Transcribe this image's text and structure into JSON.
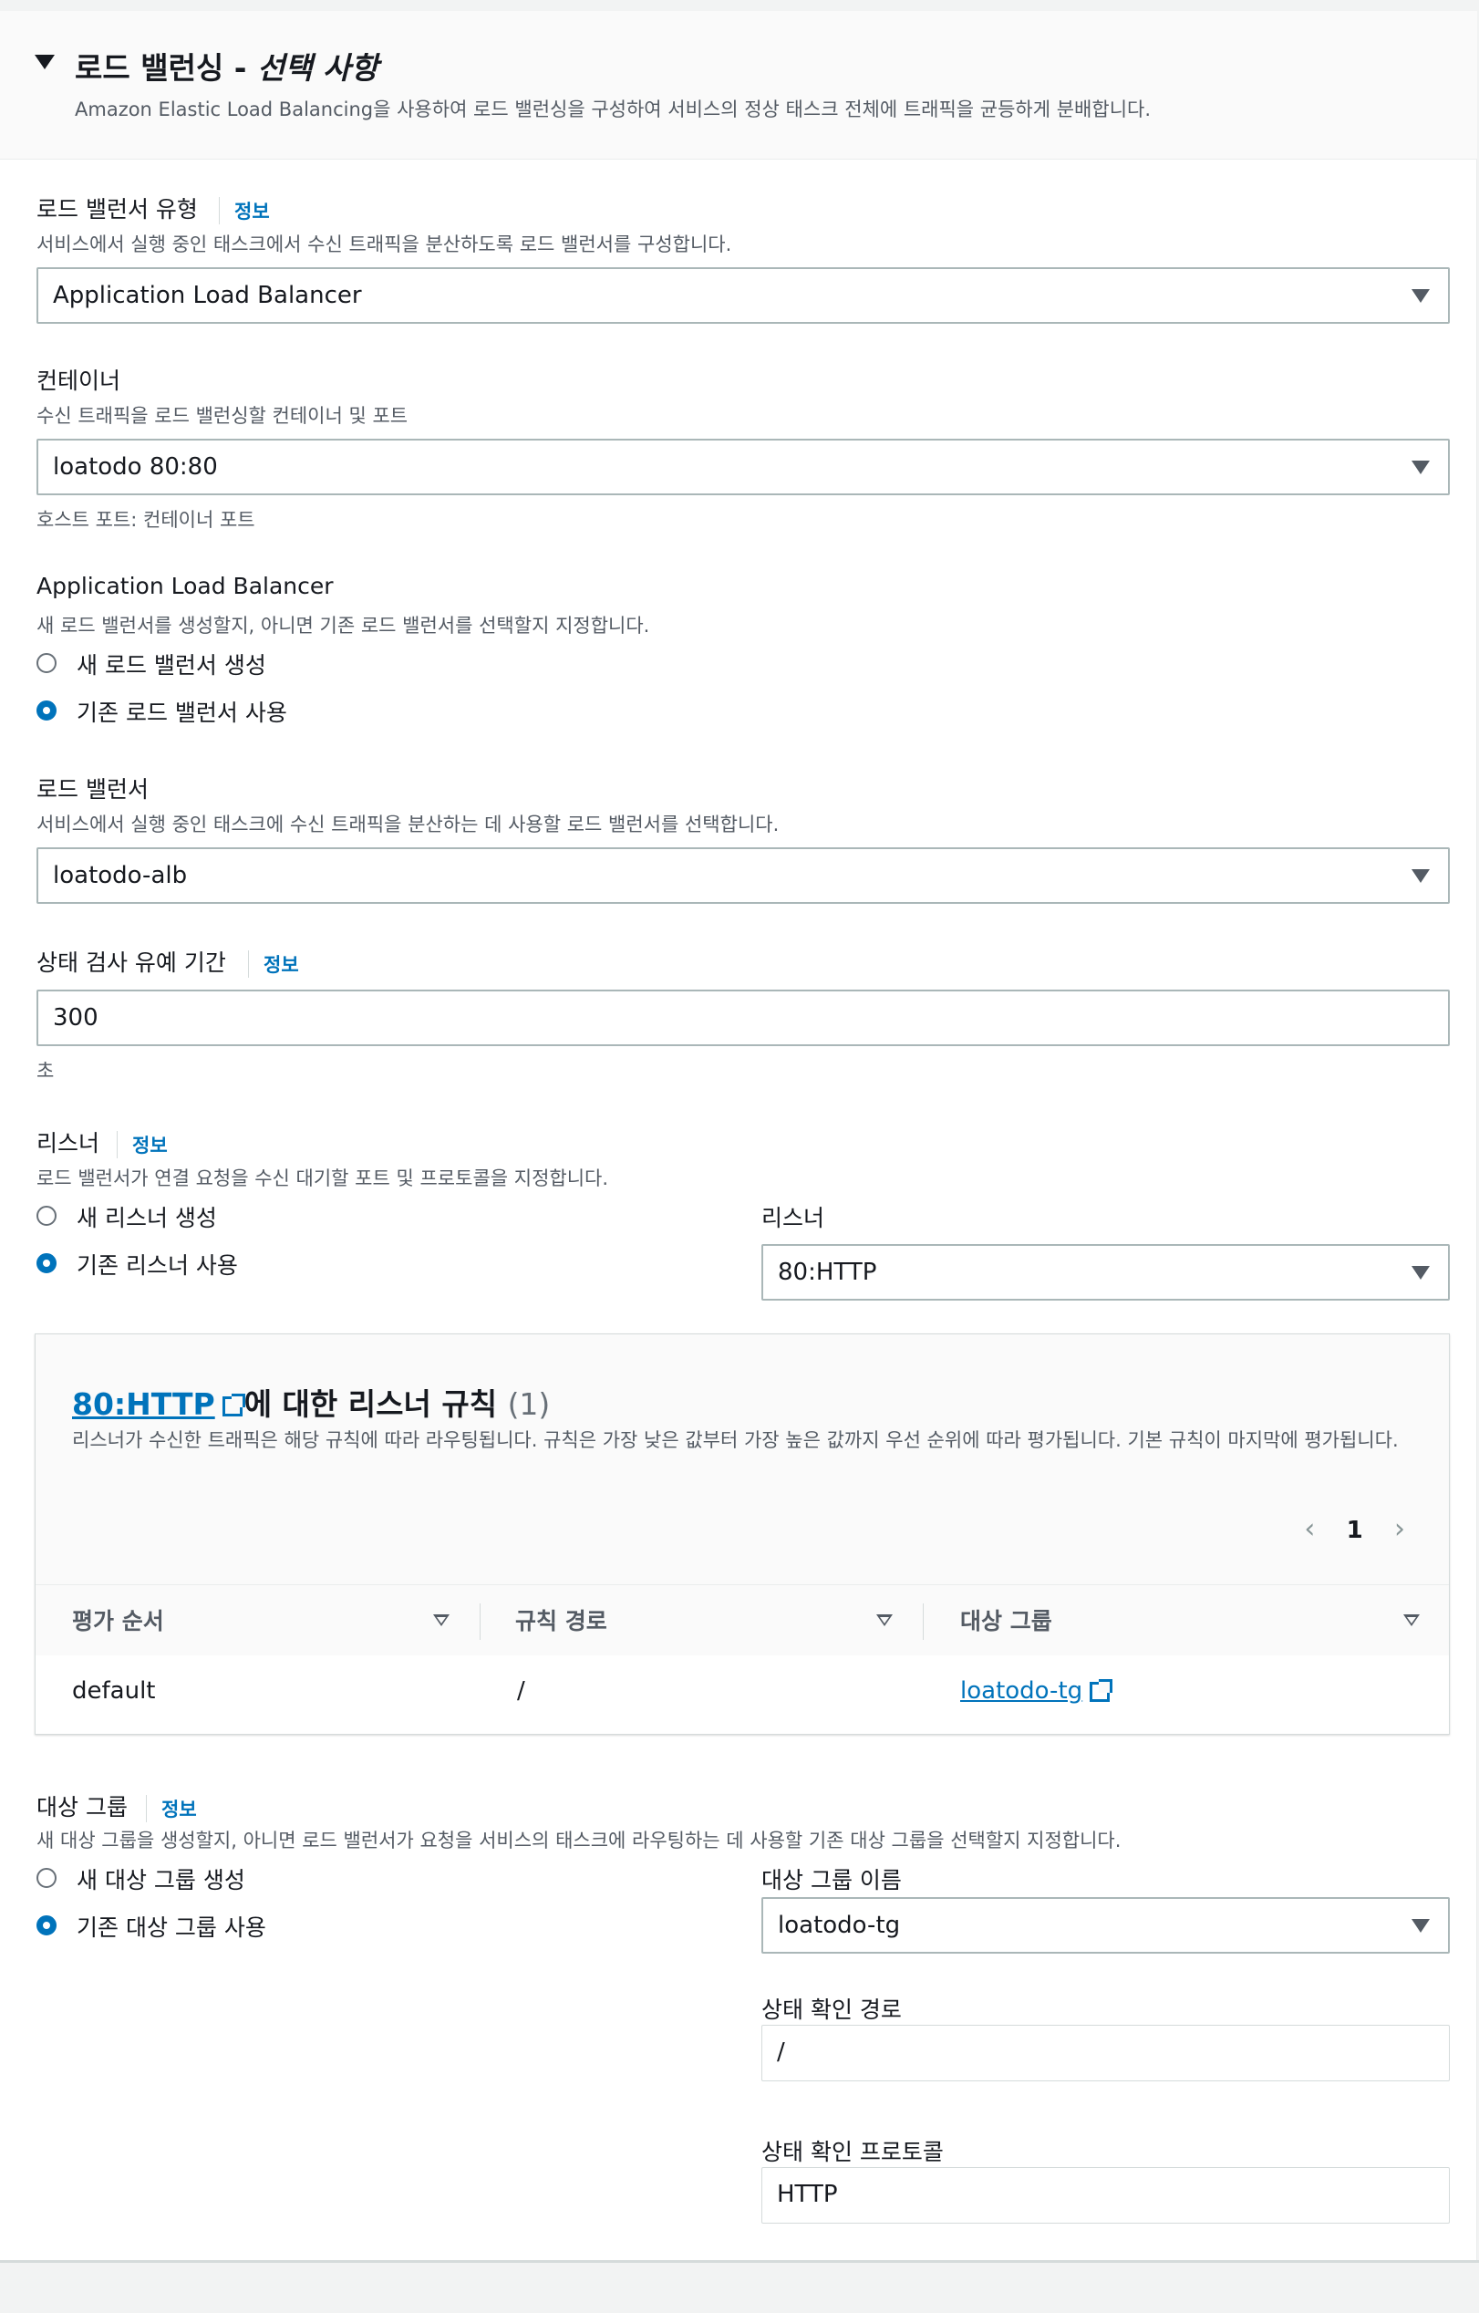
{
  "section": {
    "title": "로드 밸런싱 - ",
    "title_italic": "선택 사항",
    "description": "Amazon Elastic Load Balancing을 사용하여 로드 밸런싱을 구성하여 서비스의 정상 태스크 전체에 트래픽을 균등하게 분배합니다."
  },
  "lb_type": {
    "label": "로드 밸런서 유형",
    "info": "정보",
    "description": "서비스에서 실행 중인 태스크에서 수신 트래픽을 분산하도록 로드 밸런서를 구성합니다.",
    "value": "Application Load Balancer"
  },
  "container": {
    "label": "컨테이너",
    "description": "수신 트래픽을 로드 밸런싱할 컨테이너 및 포트",
    "value": "loatodo 80:80",
    "hint": "호스트 포트: 컨테이너 포트"
  },
  "alb": {
    "label": "Application Load Balancer",
    "description": "새 로드 밸런서를 생성할지, 아니면 기존 로드 밸런서를 선택할지 지정합니다.",
    "options": [
      "새 로드 밸런서 생성",
      "기존 로드 밸런서 사용"
    ],
    "selected": 1
  },
  "load_balancer": {
    "label": "로드 밸런서",
    "description": "서비스에서 실행 중인 태스크에 수신 트래픽을 분산하는 데 사용할 로드 밸런서를 선택합니다.",
    "value": "loatodo-alb"
  },
  "grace": {
    "label": "상태 검사 유예 기간",
    "info": "정보",
    "value": "300",
    "unit": "초"
  },
  "listener": {
    "label": "리스너",
    "info": "정보",
    "description": "로드 밸런서가 연결 요청을 수신 대기할 포트 및 프로토콜을 지정합니다.",
    "options": [
      "새 리스너 생성",
      "기존 리스너 사용"
    ],
    "selected": 1,
    "select_label": "리스너",
    "value": "80:HTTP"
  },
  "rules": {
    "link": "80:HTTP",
    "title_suffix": "에 대한 리스너 규칙",
    "count": "(1)",
    "description": "리스너가 수신한 트래픽은 해당 규칙에 따라 라우팅됩니다. 규칙은 가장 낮은 값부터 가장 높은 값까지 우선 순위에 따라 평가됩니다. 기본 규칙이 마지막에 평가됩니다.",
    "page": "1",
    "columns": [
      "평가 순서",
      "규칙 경로",
      "대상 그룹"
    ],
    "rows": [
      [
        "default",
        "/",
        "loatodo-tg"
      ]
    ]
  },
  "target_group": {
    "label": "대상 그룹",
    "info": "정보",
    "description": "새 대상 그룹을 생성할지, 아니면 로드 밸런서가 요청을 서비스의 태스크에 라우팅하는 데 사용할 기존 대상 그룹을 선택할지 지정합니다.",
    "options": [
      "새 대상 그룹 생성",
      "기존 대상 그룹 사용"
    ],
    "selected": 1,
    "name_label": "대상 그룹 이름",
    "name_value": "loatodo-tg",
    "path_label": "상태 확인 경로",
    "path_value": "/",
    "protocol_label": "상태 확인 프로토콜",
    "protocol_value": "HTTP"
  },
  "colors": {
    "link": "#0073bb",
    "radio_selected": "#0073bb"
  }
}
